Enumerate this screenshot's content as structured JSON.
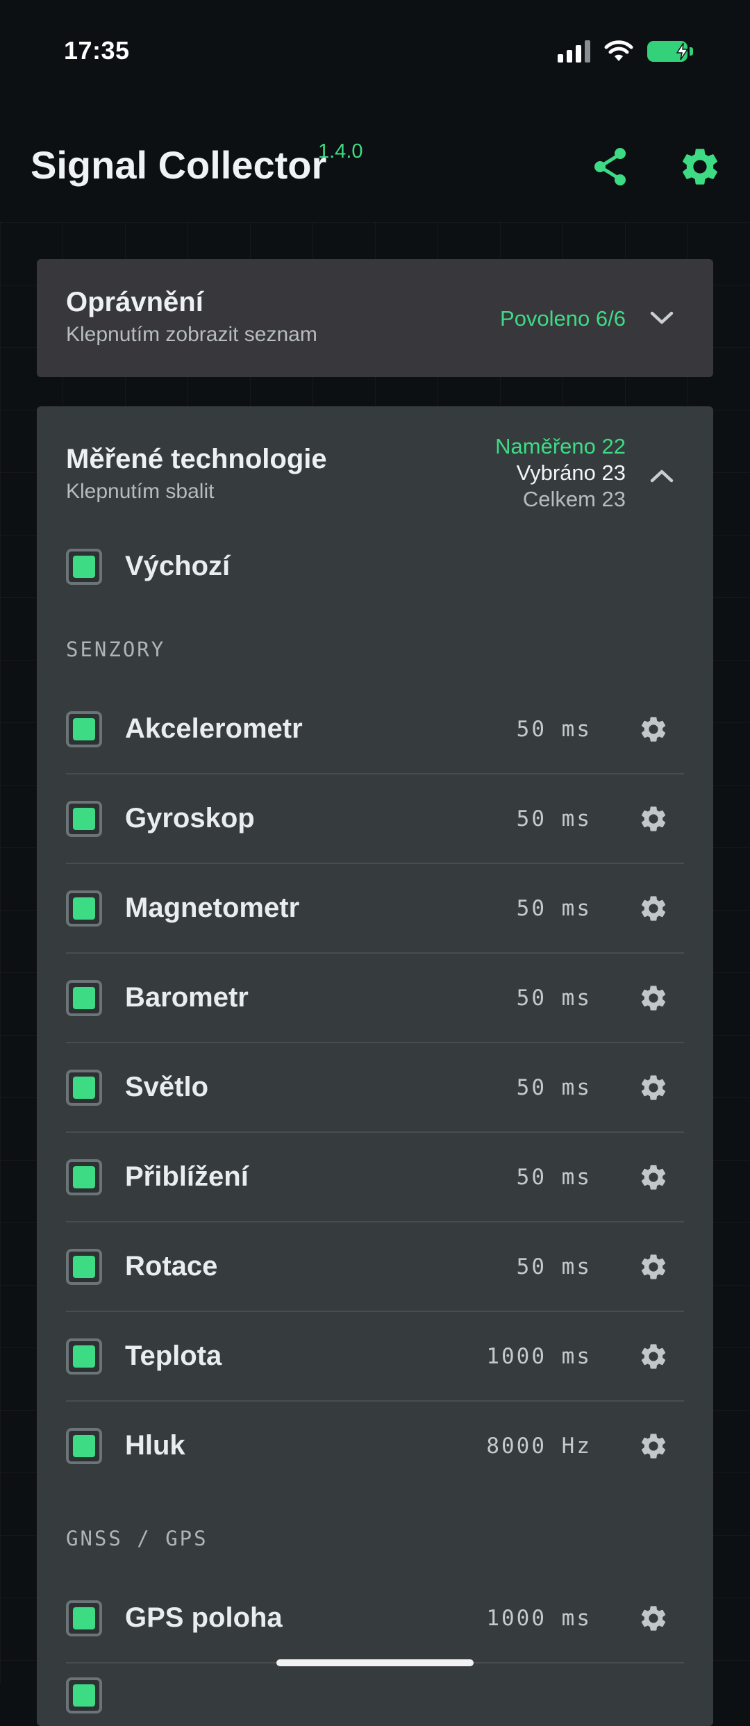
{
  "status_bar": {
    "time": "17:35"
  },
  "app_bar": {
    "title": "Signal Collector",
    "version": "1.4.0",
    "share_icon": "share-icon",
    "settings_icon": "gear-icon"
  },
  "permissions": {
    "title": "Oprávnění",
    "subtitle": "Klepnutím zobrazit seznam",
    "status": "Povoleno 6/6"
  },
  "technologies": {
    "title": "Měřené technologie",
    "subtitle": "Klepnutím sbalit",
    "measured": "Naměřeno 22",
    "selected": "Vybráno 23",
    "total": "Celkem 23",
    "default_label": "Výchozí",
    "sections": [
      {
        "heading": "SENZORY",
        "items": [
          {
            "label": "Akcelerometr",
            "value": "50 ms",
            "checked": true
          },
          {
            "label": "Gyroskop",
            "value": "50 ms",
            "checked": true
          },
          {
            "label": "Magnetometr",
            "value": "50 ms",
            "checked": true
          },
          {
            "label": "Barometr",
            "value": "50 ms",
            "checked": true
          },
          {
            "label": "Světlo",
            "value": "50 ms",
            "checked": true
          },
          {
            "label": "Přiblížení",
            "value": "50 ms",
            "checked": true
          },
          {
            "label": "Rotace",
            "value": "50 ms",
            "checked": true
          },
          {
            "label": "Teplota",
            "value": "1000 ms",
            "checked": true
          },
          {
            "label": "Hluk",
            "value": "8000 Hz",
            "checked": true
          }
        ]
      },
      {
        "heading": "GNSS / GPS",
        "items": [
          {
            "label": "GPS poloha",
            "value": "1000 ms",
            "checked": true
          }
        ]
      }
    ]
  },
  "colors": {
    "accent": "#3ddc84",
    "background": "#0d1013",
    "card": "#363b3e",
    "permissions_card": "#38373c"
  }
}
